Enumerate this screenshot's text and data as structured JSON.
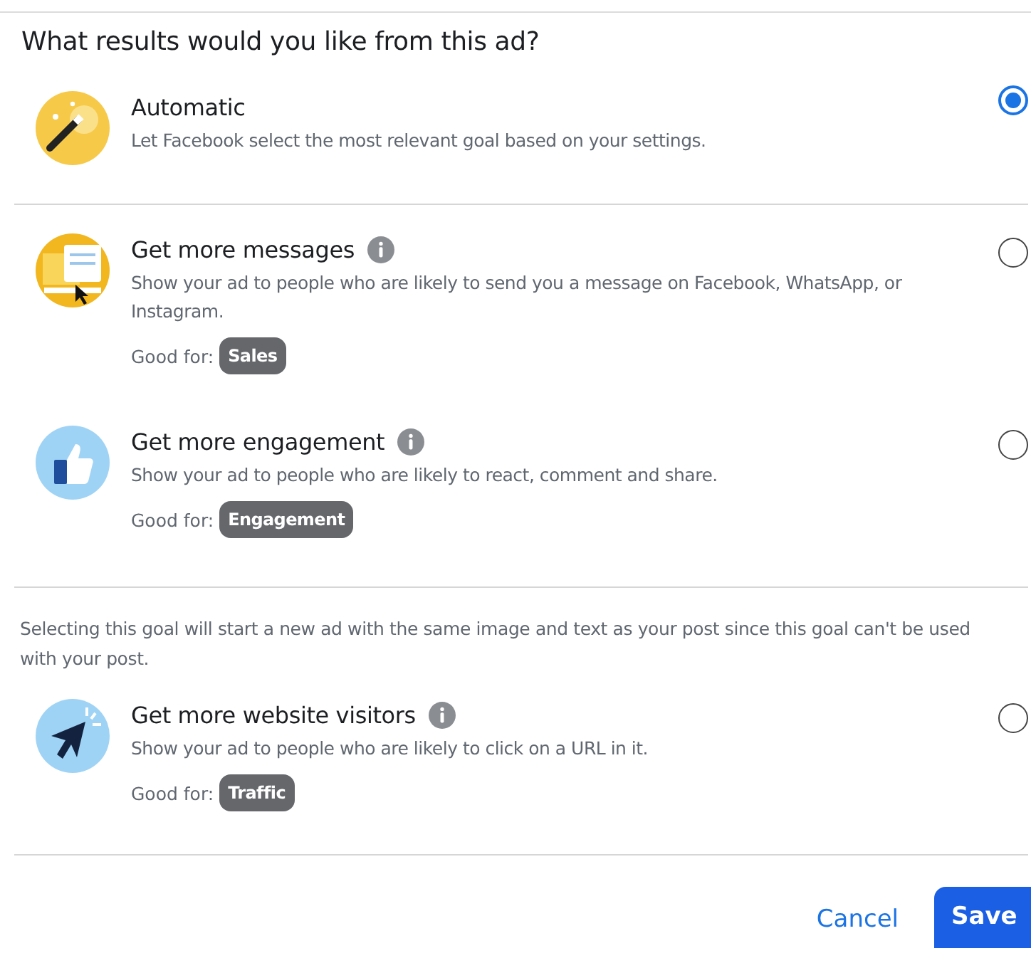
{
  "title": "What results would you like from this ad?",
  "groups": [
    {
      "options": [
        {
          "title": "Automatic",
          "info": false,
          "description": "Let Facebook select the most relevant goal based on your settings.",
          "selected": true
        }
      ]
    },
    {
      "options": [
        {
          "title": "Get more messages",
          "info": true,
          "description": "Show your ad to people who are likely to send you a message on Facebook, WhatsApp, or Instagram.",
          "good_for": "Good for:",
          "tag": "Sales",
          "selected": false
        },
        {
          "title": "Get more engagement",
          "info": true,
          "description": "Show your ad to people who are likely to react, comment and share.",
          "good_for": "Good for:",
          "tag": "Engagement",
          "selected": false
        }
      ]
    },
    {
      "note": "Selecting this goal will start a new ad with the same image and text as your post since this goal can't be used with your post.",
      "options": [
        {
          "title": "Get more website visitors",
          "info": true,
          "description": "Show your ad to people who are likely to click on a URL in it.",
          "good_for": "Good for:",
          "tag": "Traffic",
          "selected": false
        }
      ]
    }
  ],
  "buttons": {
    "cancel": "Cancel",
    "save": "Save"
  }
}
